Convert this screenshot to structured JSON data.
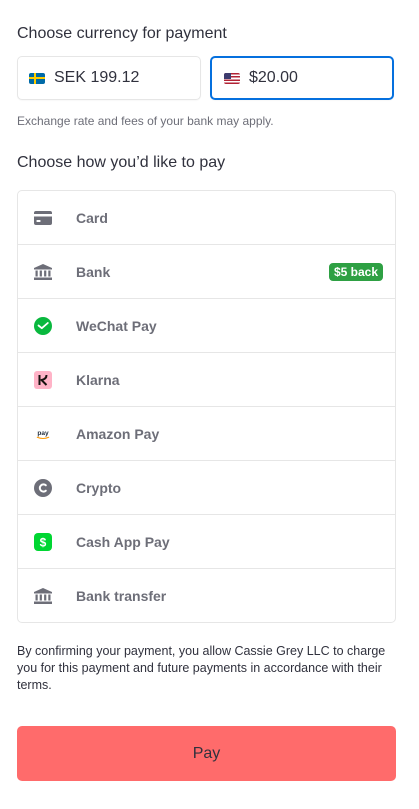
{
  "currency": {
    "title": "Choose currency for payment",
    "options": [
      {
        "code": "SEK",
        "label": "SEK 199.12",
        "flag": "sweden-flag",
        "selected": false
      },
      {
        "code": "USD",
        "label": "$20.00",
        "flag": "us-flag",
        "selected": true
      }
    ],
    "note": "Exchange rate and fees of your bank may apply."
  },
  "payment": {
    "title": "Choose how you’d like to pay",
    "methods": [
      {
        "label": "Card",
        "icon": "card-icon"
      },
      {
        "label": "Bank",
        "icon": "bank-icon",
        "badge": "$5 back"
      },
      {
        "label": "WeChat Pay",
        "icon": "wechat-pay-icon"
      },
      {
        "label": "Klarna",
        "icon": "klarna-icon"
      },
      {
        "label": "Amazon Pay",
        "icon": "amazon-pay-icon"
      },
      {
        "label": "Crypto",
        "icon": "crypto-icon"
      },
      {
        "label": "Cash App Pay",
        "icon": "cash-app-icon"
      },
      {
        "label": "Bank transfer",
        "icon": "bank-transfer-icon"
      }
    ]
  },
  "terms": "By confirming your payment, you allow Cassie Grey LLC to charge you for this payment and future payments in accordance with their terms.",
  "pay_button": {
    "label": "Pay"
  },
  "colors": {
    "selected_border": "#0570de",
    "badge_green": "#2ea043",
    "pay_button": "#ff6b6b",
    "muted_text": "#6d6e78",
    "wechat_green": "#09b83e",
    "klarna_pink": "#ffb3c7",
    "cash_app_green": "#00d632"
  }
}
